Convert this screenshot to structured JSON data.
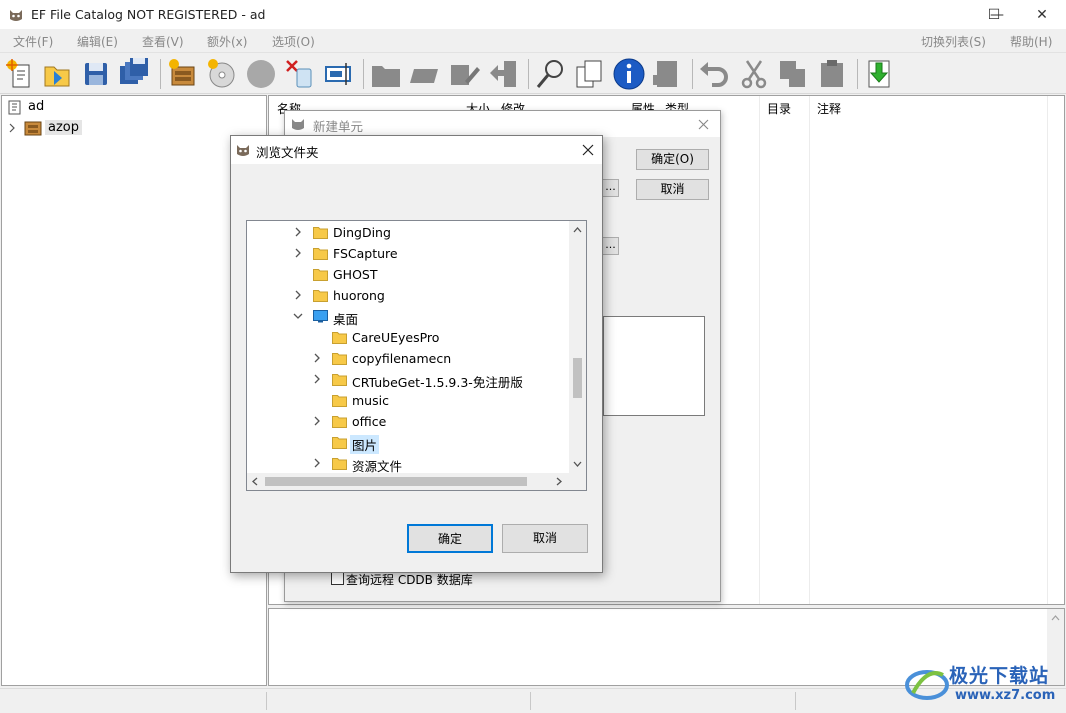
{
  "window": {
    "title": "EF File Catalog NOT REGISTERED - ad",
    "minimize_glyph": "—",
    "maximize_glyph": "☐",
    "close_glyph": "✕"
  },
  "menu": {
    "left": [
      "文件(F)",
      "编辑(E)",
      "查看(V)",
      "额外(x)",
      "选项(O)"
    ],
    "right": [
      "切换列表(S)",
      "帮助(H)"
    ]
  },
  "toolbar": {
    "icons": [
      "new-catalog-icon",
      "open-icon",
      "save-icon",
      "save-all-icon",
      "new-unit-icon",
      "cd-icon",
      "disc-icon",
      "delete-unit-icon",
      "scan-icon",
      "folder-gray-icon",
      "rename-icon",
      "edit-icon",
      "move-icon",
      "find-icon",
      "copy-doc-icon",
      "info-icon",
      "export-icon",
      "properties-icon",
      "undo-icon",
      "cut-icon",
      "copy-icon",
      "paste-icon",
      "download-icon"
    ]
  },
  "tree": {
    "root": "ad",
    "child": "azop"
  },
  "list": {
    "columns": [
      "名称",
      "大小",
      "修改",
      "属性",
      "类型",
      "目录",
      "注释"
    ]
  },
  "new_unit_dialog": {
    "title": "新建单元",
    "ok_label": "确定(O)",
    "cancel_label": "取消",
    "browse_label": "...",
    "cddb_checkbox": "查询远程 CDDB 数据库"
  },
  "browse_dialog": {
    "title": "浏览文件夹",
    "ok_label": "确定",
    "cancel_label": "取消",
    "folders": [
      {
        "label": "DingDing",
        "expandable": true,
        "level": 0
      },
      {
        "label": "FSCapture",
        "expandable": true,
        "level": 0
      },
      {
        "label": "GHOST",
        "expandable": false,
        "level": 0
      },
      {
        "label": "huorong",
        "expandable": true,
        "level": 0
      },
      {
        "label": "桌面",
        "expandable": true,
        "expanded": true,
        "level": 0,
        "icon": "desktop-icon"
      },
      {
        "label": "CareUEyesPro",
        "expandable": false,
        "level": 1
      },
      {
        "label": "copyfilenamecn",
        "expandable": true,
        "level": 1
      },
      {
        "label": "CRTubeGet-1.5.9.3-免注册版",
        "expandable": true,
        "level": 1
      },
      {
        "label": "music",
        "expandable": false,
        "level": 1
      },
      {
        "label": "office",
        "expandable": true,
        "level": 1
      },
      {
        "label": "图片",
        "expandable": false,
        "level": 1,
        "selected": true
      },
      {
        "label": "资源文件",
        "expandable": true,
        "level": 1
      }
    ]
  },
  "watermark": {
    "name": "极光下载站",
    "url": "www.xz7.com"
  },
  "colors": {
    "selection": "#cce8ff",
    "folder": "#f7c948",
    "accent_blue": "#0078d7"
  }
}
